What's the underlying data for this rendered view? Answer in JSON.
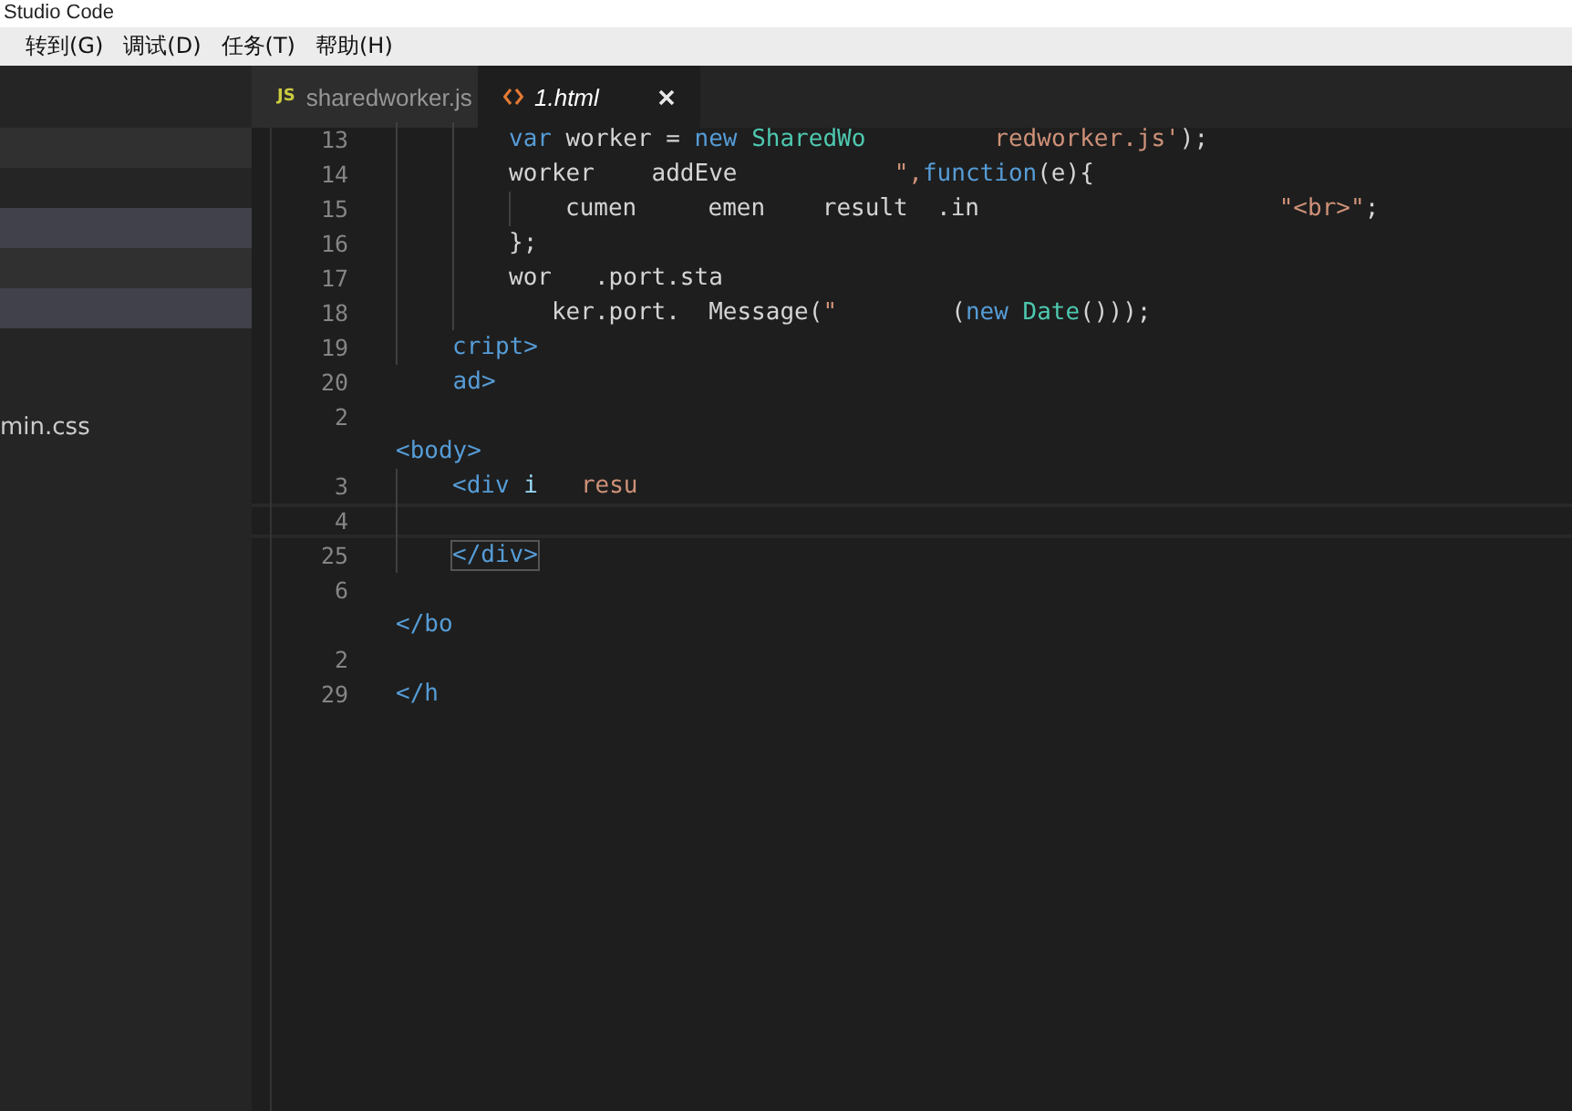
{
  "window": {
    "title": "Studio Code"
  },
  "menu": [
    "转到(G)",
    "调试(D)",
    "任务(T)",
    "帮助(H)"
  ],
  "sidebar": {
    "rows": [
      {
        "selected": false
      },
      {
        "selected": true
      },
      {
        "selected": false
      },
      {
        "selected": true
      }
    ],
    "file_label": "min.css"
  },
  "tabs": [
    {
      "label": "sharedworker.js",
      "kind": "js",
      "icon_text": "JS",
      "selected": false
    },
    {
      "label": "1.html",
      "kind": "html",
      "selected": true
    }
  ],
  "editor": {
    "lines": [
      {
        "children": [
          {
            "children": [
              {
                "number": "13",
                "code": [
                  {
                    "text": "var",
                    "kind": "keyword"
                  },
                  {
                    "text": " worker = ",
                    "kind": "plain"
                  },
                  {
                    "text": "new",
                    "kind": "keyword"
                  },
                  {
                    "text": " SharedWo         ",
                    "kind": "type"
                  },
                  {
                    "text": "redworker.js'",
                    "kind": "string"
                  },
                  {
                    "text": ");",
                    "kind": "plain"
                  }
                ]
              },
              {
                "number": "14",
                "code": [
                  {
                    "text": "worker    addEve           ",
                    "kind": "plain"
                  },
                  {
                    "text": "\",",
                    "kind": "string"
                  },
                  {
                    "text": "function",
                    "kind": "keyword"
                  },
                  {
                    "text": "(e){",
                    "kind": "plain"
                  }
                ]
              },
              {
                "children": [
                  {
                    "number": "15",
                    "code": [
                      {
                        "text": "cumen     emen    ",
                        "kind": "plain"
                      },
                      {
                        "text": "result  .in                     ",
                        "kind": "plain"
                      },
                      {
                        "text": "\"<br>\"",
                        "kind": "string"
                      },
                      {
                        "text": ";",
                        "kind": "plain"
                      }
                    ]
                  }
                ]
              },
              {
                "number": "16",
                "code": [
                  {
                    "text": "};",
                    "kind": "plain"
                  }
                ]
              },
              {
                "number": "17",
                "code": [
                  {
                    "text": "wor   .port.sta",
                    "kind": "plain"
                  }
                ]
              },
              {
                "number": "18",
                "code": [
                  {
                    "text": "   ker.port.  Message(",
                    "kind": "plain"
                  },
                  {
                    "text": "\"        ",
                    "kind": "string"
                  },
                  {
                    "text": "(",
                    "kind": "plain"
                  },
                  {
                    "text": "new",
                    "kind": "keyword"
                  },
                  {
                    "text": " Date",
                    "kind": "type"
                  },
                  {
                    "text": "()));",
                    "kind": "plain"
                  }
                ]
              }
            ]
          },
          {
            "number": "19",
            "code": [
              {
                "text": "cript>",
                "kind": "tag"
              }
            ]
          }
        ]
      },
      {
        "number": "20",
        "code": [
          {
            "text": "    ad>",
            "kind": "tag"
          }
        ]
      },
      {
        "number": "2"
      },
      {
        "code": [
          {
            "text": "<body>",
            "kind": "tag"
          }
        ]
      },
      {
        "children": [
          {
            "number": "3",
            "code": [
              {
                "text": "<div",
                "kind": "tag"
              },
              {
                "text": " i   ",
                "kind": "attr"
              },
              {
                "text": "resu",
                "kind": "string"
              }
            ]
          },
          {
            "number": "4",
            "current": true
          },
          {
            "number": "25",
            "code": [
              {
                "text": "</div>",
                "kind": "tag"
              }
            ],
            "bracket_match": true
          }
        ]
      },
      {
        "number": "6"
      },
      {
        "code": [
          {
            "text": "</bo",
            "kind": "tag"
          }
        ]
      },
      {
        "number": "2"
      },
      {
        "number": "29",
        "code": [
          {
            "text": "</h",
            "kind": "tag"
          }
        ]
      }
    ]
  }
}
